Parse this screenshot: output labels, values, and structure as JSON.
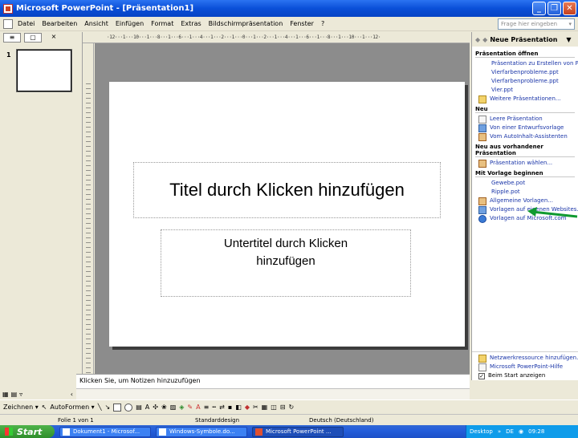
{
  "window": {
    "title": "Microsoft PowerPoint - [Präsentation1]"
  },
  "menu": {
    "items": [
      "Datei",
      "Bearbeiten",
      "Ansicht",
      "Einfügen",
      "Format",
      "Extras",
      "Bildschirmpräsentation",
      "Fenster",
      "?"
    ]
  },
  "help": {
    "placeholder": "Frage hier eingeben"
  },
  "ruler": {
    "top_scale": "·12···1···10···1···8···1···6···1···4···1···2···1···0···1···2···1···4···1···6···1···8···1···10···1···12·"
  },
  "left_pane": {
    "slide_number": "1",
    "tabs": [
      "≡",
      "▢",
      "×"
    ]
  },
  "slide": {
    "title_placeholder": "Titel durch Klicken hinzufügen",
    "subtitle_placeholder": "Untertitel durch Klicken hinzufügen"
  },
  "notes": {
    "placeholder": "Klicken Sie, um Notizen hinzuzufügen"
  },
  "task_pane": {
    "title": "Neue Präsentation",
    "sections": {
      "open": {
        "title": "Präsentation öffnen",
        "items": [
          "Präsentation zu Erstellen von Pr",
          "Vierfarbenprobleme.ppt",
          "Vierfarbenprobleme.ppt",
          "Vier.ppt"
        ],
        "more": "Weitere Präsentationen..."
      },
      "new": {
        "title": "Neu",
        "items": [
          "Leere Präsentation",
          "Von einer Entwurfsvorlage",
          "Vom AutoInhalt-Assistenten"
        ]
      },
      "existing": {
        "title": "Neu aus vorhandener Präsentation",
        "items": [
          "Präsentation wählen..."
        ]
      },
      "template": {
        "title": "Mit Vorlage beginnen",
        "items": [
          "Gewebe.pot",
          "Ripple.pot"
        ],
        "links": [
          "Allgemeine Vorlagen...",
          "Vorlagen auf eigenen Websites...",
          "Vorlagen auf Microsoft.com"
        ]
      }
    },
    "bottom": {
      "links": [
        "Netzwerkressource hinzufügen...",
        "Microsoft PowerPoint-Hilfe"
      ],
      "checkbox": "Beim Start anzeigen"
    }
  },
  "drawbar": {
    "draw_label": "Zeichnen ▾",
    "autoshapes_label": "AutoFormen ▾"
  },
  "status": {
    "slide": "Folie 1 von 1",
    "design": "Standarddesign",
    "language": "Deutsch (Deutschland)"
  },
  "taskbar": {
    "start": "Start",
    "buttons": [
      "Dokument1 - Microsof...",
      "Windows-Symbole.do...",
      "Microsoft PowerPoint ..."
    ],
    "tray_desktop": "Desktop",
    "tray_lang": "DE",
    "clock": "09:28"
  },
  "colors": {
    "title_blue": "#0a4fd8",
    "link_blue": "#1a35a8",
    "arrow_green": "#109a30",
    "canvas_gray": "#8c8c8c"
  }
}
